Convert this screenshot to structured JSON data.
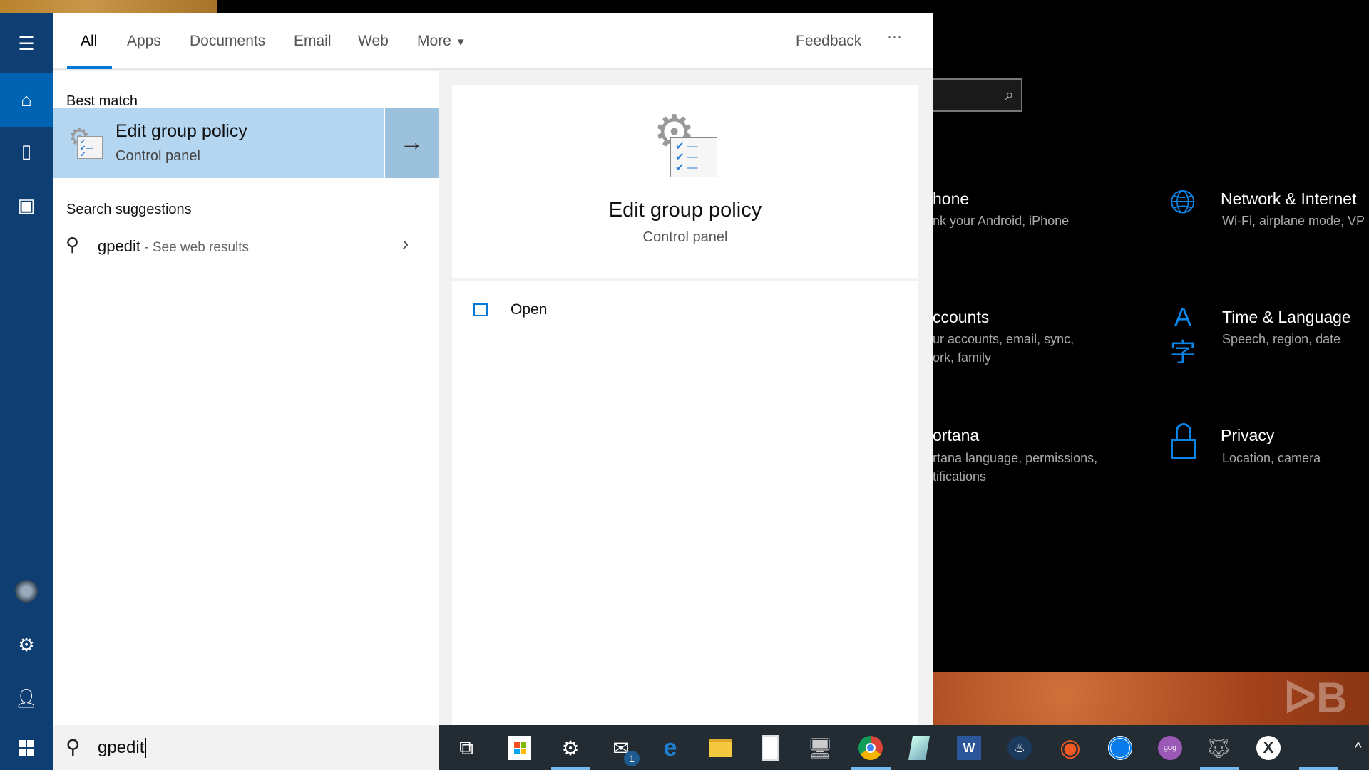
{
  "search_panel": {
    "tabs": [
      {
        "label": "All",
        "active": true
      },
      {
        "label": "Apps"
      },
      {
        "label": "Documents"
      },
      {
        "label": "Email"
      },
      {
        "label": "Web"
      },
      {
        "label": "More"
      }
    ],
    "feedback_label": "Feedback",
    "more_options_label": "···",
    "best_match_header": "Best match",
    "best_match": {
      "title": "Edit group policy",
      "subtitle": "Control panel"
    },
    "suggestions_header": "Search suggestions",
    "suggestion": {
      "query": "gpedit",
      "suffix": " - See web results"
    },
    "preview": {
      "title": "Edit group policy",
      "subtitle": "Control panel"
    },
    "actions": [
      {
        "label": "Open",
        "icon": "open-icon"
      }
    ],
    "search_input_value": "gpedit"
  },
  "background_settings": {
    "items": [
      {
        "title": "hone",
        "subtitle": [
          "nk your Android, iPhone"
        ]
      },
      {
        "title": "Network & Internet",
        "subtitle": [
          "Wi-Fi, airplane mode, VP"
        ],
        "icon": "globe-icon"
      },
      {
        "title": "ccounts",
        "subtitle": [
          "ur accounts, email, sync,",
          "ork, family"
        ]
      },
      {
        "title": "Time & Language",
        "subtitle": [
          "Speech, region, date"
        ],
        "icon": "time-language-icon"
      },
      {
        "title": "ortana",
        "subtitle": [
          "rtana language, permissions,",
          "tifications"
        ]
      },
      {
        "title": "Privacy",
        "subtitle": [
          "Location, camera"
        ],
        "icon": "lock-icon"
      }
    ]
  },
  "taskbar": {
    "mail_badge": "1",
    "icons": [
      "task-view",
      "store",
      "settings",
      "mail",
      "edge",
      "file-explorer",
      "calculator",
      "remote-desktop",
      "chrome",
      "notes",
      "word",
      "steam",
      "origin",
      "uplay",
      "gog",
      "gimp",
      "xbox"
    ],
    "running": [
      "settings",
      "chrome",
      "gimp",
      "xbox"
    ]
  },
  "colors": {
    "accent": "#0078d7",
    "sidebar": "#0e3e72",
    "selection": "#b5d6f1",
    "taskbar": "#232b33"
  }
}
